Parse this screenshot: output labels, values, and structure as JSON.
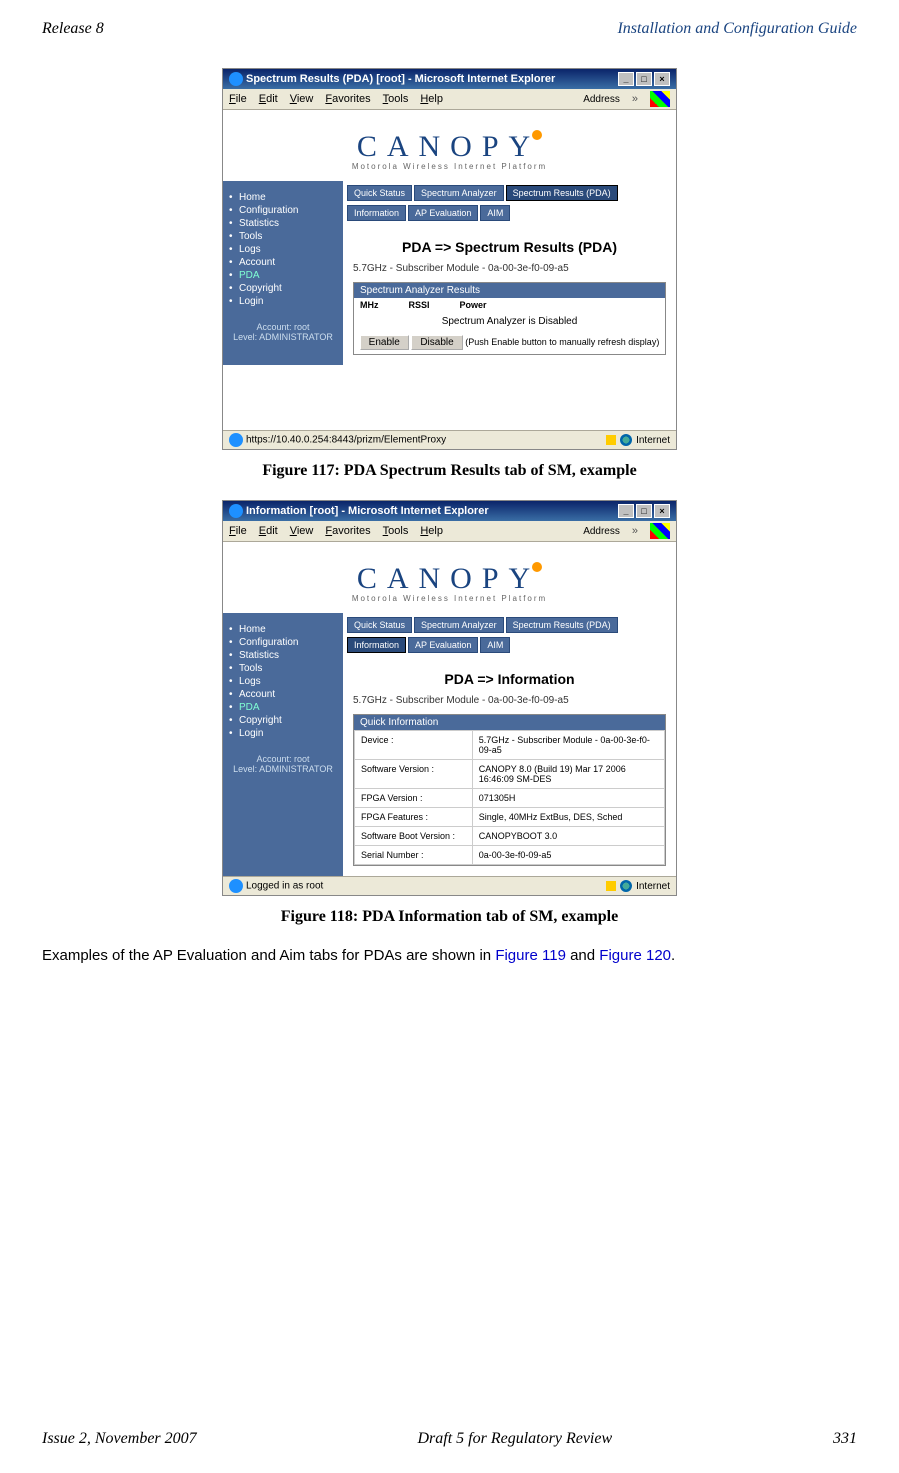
{
  "header": {
    "left": "Release 8",
    "right": "Installation and Configuration Guide"
  },
  "fig1": {
    "caption": "Figure 117: PDA Spectrum Results tab of SM, example",
    "window_title": "Spectrum Results (PDA) [root] - Microsoft Internet Explorer",
    "menubar": [
      "File",
      "Edit",
      "View",
      "Favorites",
      "Tools",
      "Help"
    ],
    "address_label": "Address",
    "logo_text": "CANOPY",
    "logo_sub": "Motorola Wireless Internet Platform",
    "sidebar": {
      "items": [
        "Home",
        "Configuration",
        "Statistics",
        "Tools",
        "Logs",
        "Account",
        "PDA",
        "Copyright",
        "Login"
      ],
      "active_index": 6,
      "account_label": "Account: root",
      "level_label": "Level: ADMINISTRATOR"
    },
    "tabs_row1": [
      "Quick Status",
      "Spectrum Analyzer",
      "Spectrum Results (PDA)"
    ],
    "tabs_row2": [
      "Information",
      "AP Evaluation",
      "AIM"
    ],
    "active_tab": "Spectrum Results (PDA)",
    "page_title": "PDA => Spectrum Results (PDA)",
    "device_line": "5.7GHz - Subscriber Module - 0a-00-3e-f0-09-a5",
    "panel_title": "Spectrum Analyzer Results",
    "col_headers": [
      "MHz",
      "RSSI",
      "Power"
    ],
    "disabled_text": "Spectrum Analyzer is Disabled",
    "enable_btn": "Enable",
    "disable_btn": "Disable",
    "btn_note": "(Push Enable button to manually refresh display)",
    "status_left": "https://10.40.0.254:8443/prizm/ElementProxy",
    "status_right": "Internet"
  },
  "fig2": {
    "caption": "Figure 118: PDA Information tab of SM, example",
    "window_title": "Information [root] - Microsoft Internet Explorer",
    "menubar": [
      "File",
      "Edit",
      "View",
      "Favorites",
      "Tools",
      "Help"
    ],
    "address_label": "Address",
    "logo_text": "CANOPY",
    "logo_sub": "Motorola Wireless Internet Platform",
    "sidebar": {
      "items": [
        "Home",
        "Configuration",
        "Statistics",
        "Tools",
        "Logs",
        "Account",
        "PDA",
        "Copyright",
        "Login"
      ],
      "active_index": 6,
      "account_label": "Account: root",
      "level_label": "Level: ADMINISTRATOR"
    },
    "tabs_row1": [
      "Quick Status",
      "Spectrum Analyzer",
      "Spectrum Results (PDA)"
    ],
    "tabs_row2": [
      "Information",
      "AP Evaluation",
      "AIM"
    ],
    "active_tab": "Information",
    "page_title": "PDA => Information",
    "device_line": "5.7GHz - Subscriber Module - 0a-00-3e-f0-09-a5",
    "panel_title": "Quick Information",
    "info_rows": [
      {
        "label": "Device :",
        "value": "5.7GHz - Subscriber Module - 0a-00-3e-f0-09-a5"
      },
      {
        "label": "Software Version :",
        "value": "CANOPY 8.0 (Build 19) Mar 17 2006 16:46:09 SM-DES"
      },
      {
        "label": "FPGA Version :",
        "value": "071305H"
      },
      {
        "label": "FPGA Features :",
        "value": "Single, 40MHz ExtBus, DES, Sched"
      },
      {
        "label": "Software Boot Version :",
        "value": "CANOPYBOOT 3.0"
      },
      {
        "label": "Serial Number :",
        "value": "0a-00-3e-f0-09-a5"
      }
    ],
    "status_left": "Logged in as root",
    "status_right": "Internet"
  },
  "body": {
    "text_before": "Examples of the AP Evaluation and Aim tabs for PDAs are shown in ",
    "link1": "Figure 119",
    "text_mid": " and ",
    "link2": "Figure 120",
    "text_after": "."
  },
  "footer": {
    "left": "Issue 2, November 2007",
    "center": "Draft 5 for Regulatory Review",
    "right": "331"
  }
}
